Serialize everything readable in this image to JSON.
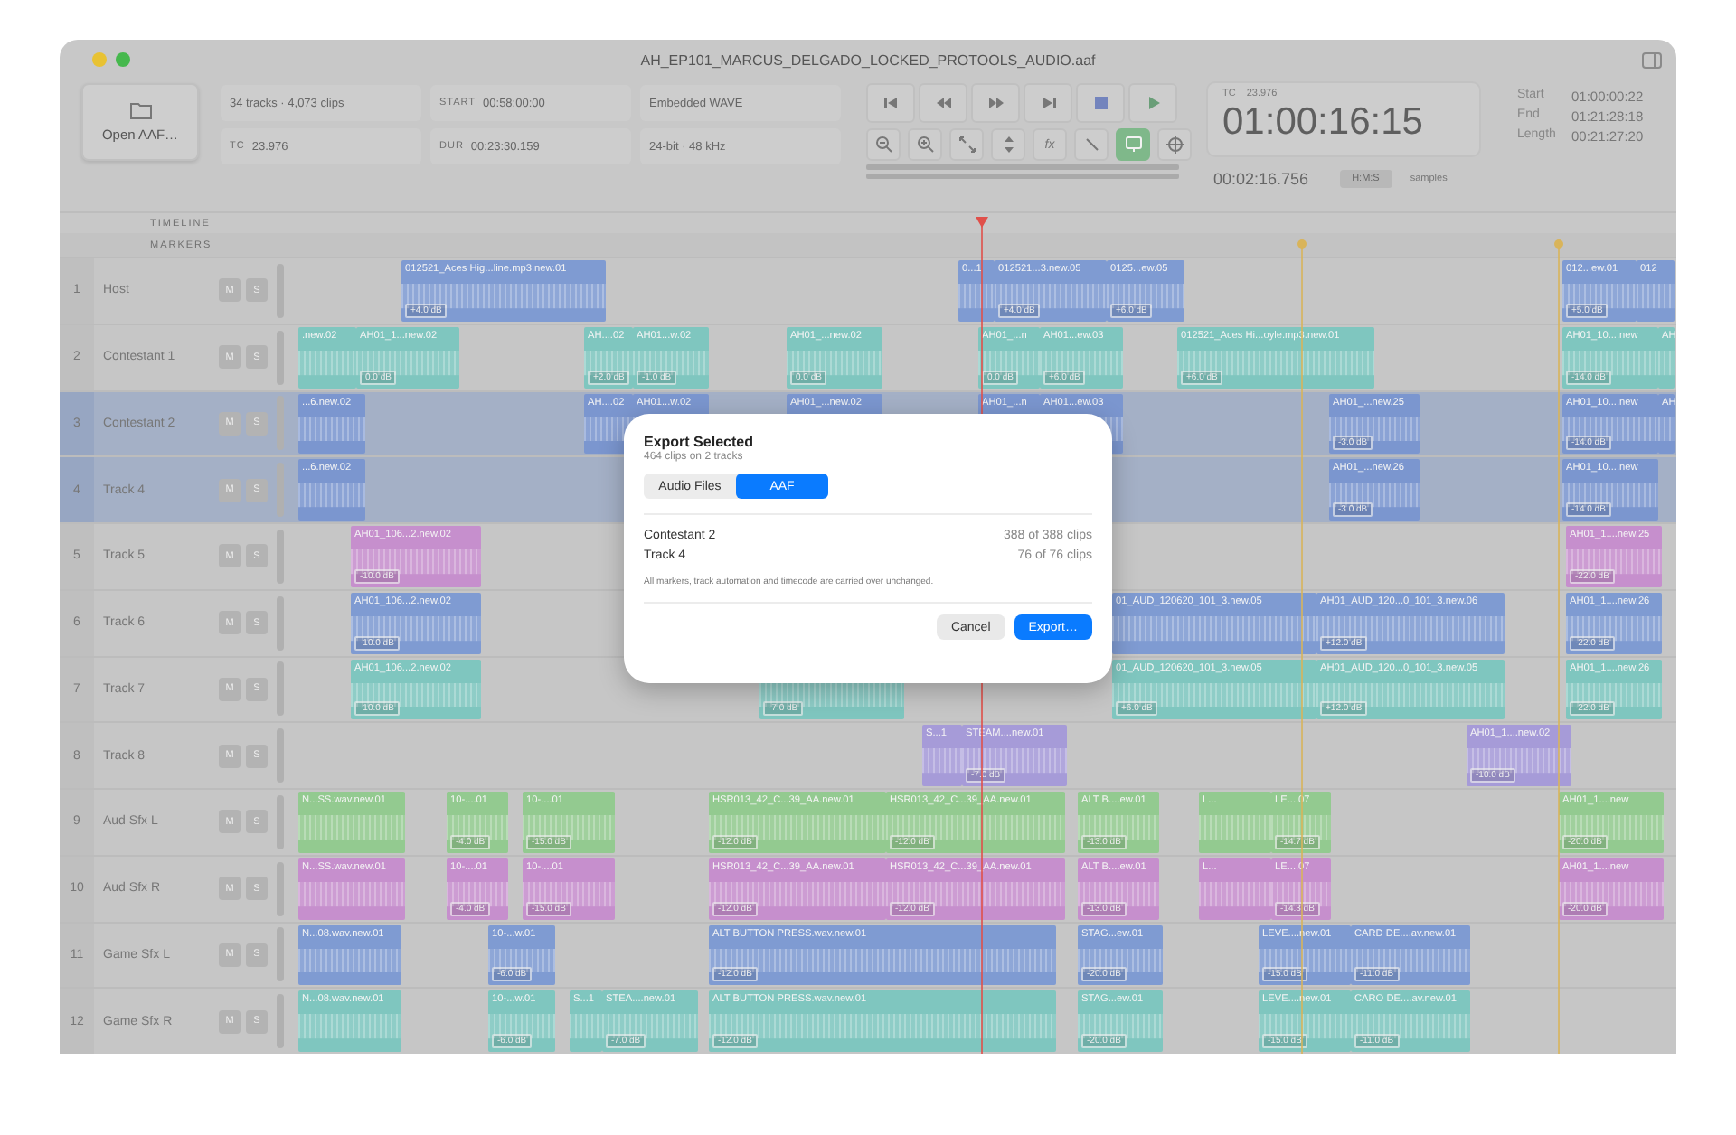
{
  "window": {
    "title": "AH_EP101_MARCUS_DELGADO_LOCKED_PROTOOLS_AUDIO.aaf"
  },
  "open_button": {
    "label": "Open AAF…"
  },
  "info": [
    {
      "value": "34 tracks · 4,073 clips"
    },
    {
      "label": "START",
      "value": "00:58:00:00"
    },
    {
      "value": "Embedded WAVE"
    },
    {
      "label": "TC",
      "value": "23.976"
    },
    {
      "label": "DUR",
      "value": "00:23:30.159"
    },
    {
      "value": "24-bit · 48 kHz"
    }
  ],
  "transport": [
    {
      "kind": "start"
    },
    {
      "kind": "rewind"
    },
    {
      "kind": "forward"
    },
    {
      "kind": "end"
    },
    {
      "kind": "stop"
    },
    {
      "kind": "play"
    }
  ],
  "tools": [
    {
      "kind": "zoom-out",
      "selected": false
    },
    {
      "kind": "zoom-in",
      "selected": false
    },
    {
      "kind": "fit",
      "selected": false
    },
    {
      "kind": "height",
      "selected": false
    },
    {
      "kind": "fx",
      "label": "fx",
      "selected": false
    },
    {
      "kind": "link",
      "selected": false
    },
    {
      "kind": "monitor",
      "selected": true
    },
    {
      "kind": "target",
      "selected": false
    }
  ],
  "timecode": {
    "label": "TC",
    "rate": "23.976",
    "main": "01:00:16:15",
    "secondary": "00:02:16.756",
    "formats": [
      {
        "label": "H:M:S",
        "selected": true
      },
      {
        "label": "samples",
        "selected": false
      }
    ]
  },
  "range": [
    {
      "label": "Start",
      "value": "01:00:00:22"
    },
    {
      "label": "End",
      "value": "01:21:28:18"
    },
    {
      "label": "Length",
      "value": "00:21:27:20"
    }
  ],
  "ruler": {
    "timeline_label": "TIMELINE",
    "markers_label": "MARKERS"
  },
  "tracks": [
    {
      "number": "1",
      "name": "Host",
      "selected": false,
      "color": "#7f9bd2",
      "mute": "M",
      "solo": "S",
      "clips": [
        {
          "label": "012521_Aces Hig...line.mp3.new.01",
          "gain": "+4.0 dB"
        },
        {
          "label": "0...1"
        },
        {
          "label": "012521...3.new.05",
          "gain": "+4.0 dB"
        },
        {
          "label": "0125...ew.05",
          "gain": "+6.0 dB"
        },
        {
          "label": "012...ew.01",
          "gain": "+5.0 dB"
        },
        {
          "label": "012"
        }
      ]
    },
    {
      "number": "2",
      "name": "Contestant 1",
      "selected": false,
      "color": "#7fc6bf",
      "mute": "M",
      "solo": "S",
      "clips": [
        {
          "label": ".new.02"
        },
        {
          "label": "AH01_1...new.02",
          "gain": "0.0 dB"
        },
        {
          "label": "AH....02",
          "gain": "+2.0 dB"
        },
        {
          "label": "AH01...w.02",
          "gain": "-1.0 dB"
        },
        {
          "label": "AH01_...new.02",
          "gain": "0.0 dB"
        },
        {
          "label": "AH01_...n",
          "gain": "0.0 dB"
        },
        {
          "label": "AH01...ew.03",
          "gain": "+6.0 dB"
        },
        {
          "label": "012521_Aces Hi...oyle.mp3.new.01",
          "gain": "+6.0 dB"
        },
        {
          "label": "AH01_10....new",
          "gain": "-14.0 dB"
        },
        {
          "label": "AH"
        }
      ]
    },
    {
      "number": "3",
      "name": "Contestant 2",
      "selected": true,
      "color": "#7b96cf",
      "mute": "M",
      "solo": "S",
      "clips": [
        {
          "label": "...6.new.02"
        },
        {
          "label": "AH....02"
        },
        {
          "label": "AH01...w.02"
        },
        {
          "label": "AH01_...new.02"
        },
        {
          "label": "AH01_...n"
        },
        {
          "label": "AH01...ew.03"
        },
        {
          "label": "AH01_...new.25",
          "gain": "-3.0 dB"
        },
        {
          "label": "AH01_10....new",
          "gain": "-14.0 dB"
        },
        {
          "label": "AH"
        }
      ]
    },
    {
      "number": "4",
      "name": "Track 4",
      "selected": true,
      "color": "#7b96cf",
      "mute": "M",
      "solo": "S",
      "clips": [
        {
          "label": "...6.new.02"
        },
        {
          "label": "AH01_...new.26",
          "gain": "-3.0 dB"
        },
        {
          "label": "AH01_10....new",
          "gain": "-14.0 dB"
        }
      ]
    },
    {
      "number": "5",
      "name": "Track 5",
      "selected": false,
      "color": "#c68fcd",
      "mute": "M",
      "solo": "S",
      "clips": [
        {
          "label": "AH01_106...2.new.02",
          "gain": "-10.0 dB"
        },
        {
          "label": "AH01_1....new.25",
          "gain": "-22.0 dB"
        }
      ]
    },
    {
      "number": "6",
      "name": "Track 6",
      "selected": false,
      "color": "#7f9bd2",
      "mute": "M",
      "solo": "S",
      "clips": [
        {
          "label": "AH01_106...2.new.02",
          "gain": "-10.0 dB"
        },
        {
          "label": "01_AUD_120620_101_3.new.05"
        },
        {
          "label": "AH01_AUD_120...0_101_3.new.06",
          "gain": "+12.0 dB"
        },
        {
          "label": "AH01_1....new.26",
          "gain": "-22.0 dB"
        }
      ]
    },
    {
      "number": "7",
      "name": "Track 7",
      "selected": false,
      "color": "#7fc6bf",
      "mute": "M",
      "solo": "S",
      "clips": [
        {
          "label": "AH01_106...2.new.02",
          "gain": "-10.0 dB"
        },
        {
          "gain": "-7.0 dB"
        },
        {
          "label": "01_AUD_120620_101_3.new.05",
          "gain": "+6.0 dB"
        },
        {
          "label": "AH01_AUD_120...0_101_3.new.05",
          "gain": "+12.0 dB"
        },
        {
          "label": "AH01_1....new.26",
          "gain": "-22.0 dB"
        }
      ]
    },
    {
      "number": "8",
      "name": "Track 8",
      "selected": false,
      "color": "#a69bd8",
      "mute": "M",
      "solo": "S",
      "clips": [
        {
          "label": "S...1"
        },
        {
          "label": "STEAM....new.01",
          "gain": "-7.0 dB"
        },
        {
          "label": "AH01_1....new.02",
          "gain": "-10.0 dB"
        }
      ]
    },
    {
      "number": "9",
      "name": "Aud Sfx L",
      "selected": false,
      "color": "#93ca90",
      "mute": "M",
      "solo": "S",
      "clips": [
        {
          "label": "N...SS.wav.new.01"
        },
        {
          "label": "10-....01",
          "gain": "-4.0 dB"
        },
        {
          "label": "10-....01",
          "gain": "-15.0 dB"
        },
        {
          "label": "HSR013_42_C...39_AA.new.01",
          "gain": "-12.0 dB"
        },
        {
          "label": "HSR013_42_C...39_AA.new.01",
          "gain": "-12.0 dB"
        },
        {
          "label": "ALT B....ew.01",
          "gain": "-13.0 dB"
        },
        {
          "label": "L..."
        },
        {
          "label": "LE....07",
          "gain": "-14.7 dB"
        },
        {
          "label": "AH01_1....new",
          "gain": "-20.0 dB"
        }
      ]
    },
    {
      "number": "10",
      "name": "Aud Sfx R",
      "selected": false,
      "color": "#c68fcd",
      "mute": "M",
      "solo": "S",
      "clips": [
        {
          "label": "N...SS.wav.new.01"
        },
        {
          "label": "10-....01",
          "gain": "-4.0 dB"
        },
        {
          "label": "10-....01",
          "gain": "-15.0 dB"
        },
        {
          "label": "HSR013_42_C...39_AA.new.01",
          "gain": "-12.0 dB"
        },
        {
          "label": "HSR013_42_C...39_AA.new.01",
          "gain": "-12.0 dB"
        },
        {
          "label": "ALT B....ew.01",
          "gain": "-13.0 dB"
        },
        {
          "label": "L..."
        },
        {
          "label": "LE....07",
          "gain": "-14.3 dB"
        },
        {
          "label": "AH01_1....new",
          "gain": "-20.0 dB"
        }
      ]
    },
    {
      "number": "11",
      "name": "Game Sfx L",
      "selected": false,
      "color": "#7f9bd2",
      "mute": "M",
      "solo": "S",
      "clips": [
        {
          "label": "N...08.wav.new.01"
        },
        {
          "label": "10-...w.01",
          "gain": "-6.0 dB"
        },
        {
          "label": "ALT BUTTON PRESS.wav.new.01",
          "gain": "-12.0 dB"
        },
        {
          "label": "STAG...ew.01",
          "gain": "-20.0 dB"
        },
        {
          "label": "LEVE....new.01",
          "gain": "-15.0 dB"
        },
        {
          "label": "CARD DE....av.new.01",
          "gain": "-11.0 dB"
        }
      ]
    },
    {
      "number": "12",
      "name": "Game Sfx R",
      "selected": false,
      "color": "#7fc6bf",
      "mute": "M",
      "solo": "S",
      "clips": [
        {
          "label": "N...08.wav.new.01"
        },
        {
          "label": "10-...w.01",
          "gain": "-6.0 dB"
        },
        {
          "label": "S...1"
        },
        {
          "label": "STEA....new.01",
          "gain": "-7.0 dB"
        },
        {
          "label": "ALT BUTTON PRESS.wav.new.01",
          "gain": "-12.0 dB"
        },
        {
          "label": "STAG...ew.01",
          "gain": "-20.0 dB"
        },
        {
          "label": "LEVE....new.01",
          "gain": "-15.0 dB"
        },
        {
          "label": "CARO DE....av.new.01",
          "gain": "-11.0 dB"
        }
      ]
    }
  ],
  "dialog": {
    "title": "Export Selected",
    "subtitle": "464 clips on 2 tracks",
    "tabs": [
      {
        "label": "Audio Files",
        "selected": false
      },
      {
        "label": "AAF",
        "selected": true
      }
    ],
    "rows": [
      {
        "name": "Contestant 2",
        "count": "388 of 388 clips"
      },
      {
        "name": "Track 4",
        "count": "76 of 76 clips"
      }
    ],
    "note": "All markers, track automation and timecode are carried over unchanged.",
    "buttons": [
      {
        "label": "Cancel",
        "kind": "secondary"
      },
      {
        "label": "Export…",
        "kind": "primary"
      }
    ]
  }
}
